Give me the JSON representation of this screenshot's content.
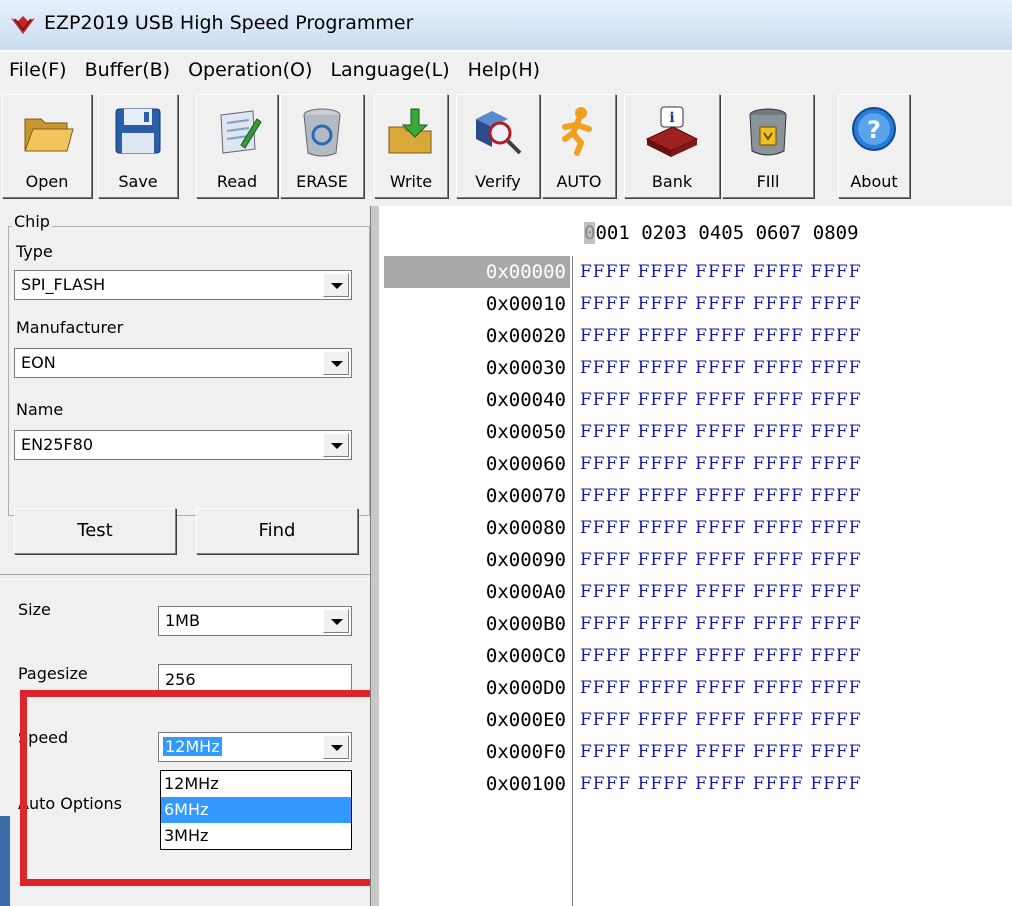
{
  "window": {
    "title": "EZP2019 USB High Speed Programmer"
  },
  "menu": [
    "File(F)",
    "Buffer(B)",
    "Operation(O)",
    "Language(L)",
    "Help(H)"
  ],
  "toolbar": {
    "open": "Open",
    "save": "Save",
    "read": "Read",
    "erase": "ERASE",
    "write": "Write",
    "verify": "Verify",
    "auto": "AUTO",
    "bank": "Bank",
    "fill": "FIll",
    "about": "About"
  },
  "chip": {
    "legend": "Chip",
    "type_label": "Type",
    "type_value": "SPI_FLASH",
    "manufacturer_label": "Manufacturer",
    "manufacturer_value": "EON",
    "name_label": "Name",
    "name_value": "EN25F80",
    "test_button": "Test",
    "find_button": "Find"
  },
  "settings": {
    "size_label": "Size",
    "size_value": "1MB",
    "pagesize_label": "Pagesize",
    "pagesize_value": "256",
    "speed_label": "Speed",
    "speed_value": "12MHz",
    "auto_options_label": "Auto Options",
    "speed_options": [
      "12MHz",
      "6MHz",
      "3MHz"
    ]
  },
  "hex": {
    "header_cursor": "0",
    "header_rest": "001 0203 0405 0607 0809",
    "addresses": [
      "0x00000",
      "0x00010",
      "0x00020",
      "0x00030",
      "0x00040",
      "0x00050",
      "0x00060",
      "0x00070",
      "0x00080",
      "0x00090",
      "0x000A0",
      "0x000B0",
      "0x000C0",
      "0x000D0",
      "0x000E0",
      "0x000F0",
      "0x00100"
    ],
    "row_data": "FFFF FFFF FFFF FFFF FFFF"
  },
  "colors": {
    "highlight": "#3399ff",
    "annotation": "#e0242c",
    "hex_data": "#1a1aa8"
  }
}
